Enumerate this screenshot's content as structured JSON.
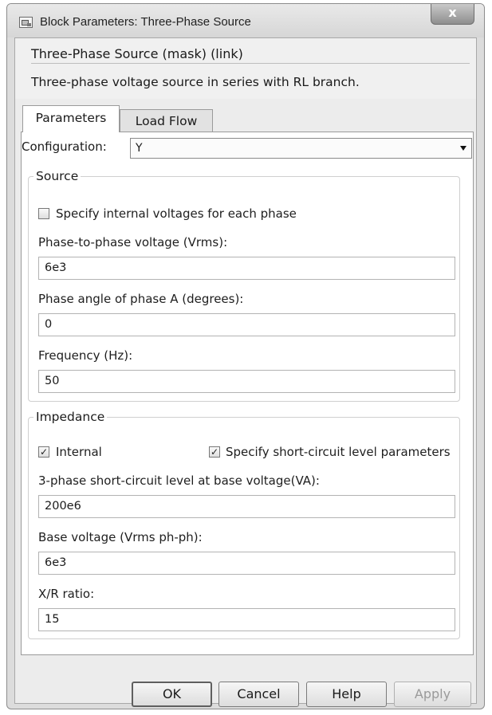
{
  "window": {
    "title": "Block Parameters: Three-Phase Source",
    "close_label": "x"
  },
  "mask": {
    "title": "Three-Phase Source (mask) (link)",
    "description": "Three-phase voltage source in series with RL branch."
  },
  "tabs": [
    {
      "label": "Parameters",
      "active": true
    },
    {
      "label": "Load Flow",
      "active": false
    }
  ],
  "configuration": {
    "label": "Configuration:",
    "value": "Y"
  },
  "source": {
    "legend": "Source",
    "specify_internal": {
      "label": "Specify internal voltages for each phase",
      "checked": false
    },
    "phase_voltage": {
      "label": "Phase-to-phase voltage (Vrms):",
      "value": "6e3"
    },
    "phase_angle": {
      "label": "Phase angle of phase A (degrees):",
      "value": "0"
    },
    "frequency": {
      "label": "Frequency (Hz):",
      "value": "50"
    }
  },
  "impedance": {
    "legend": "Impedance",
    "internal": {
      "label": "Internal",
      "checked": true
    },
    "short_circuit_params": {
      "label": "Specify short-circuit level parameters",
      "checked": true
    },
    "short_circuit_level": {
      "label": "3-phase short-circuit level at base voltage(VA):",
      "value": "200e6"
    },
    "base_voltage": {
      "label": "Base voltage (Vrms ph-ph):",
      "value": "6e3"
    },
    "xr_ratio": {
      "label": "X/R ratio:",
      "value": "15"
    }
  },
  "buttons": {
    "ok": "OK",
    "cancel": "Cancel",
    "help": "Help",
    "apply": "Apply"
  },
  "checkmark": "✓"
}
